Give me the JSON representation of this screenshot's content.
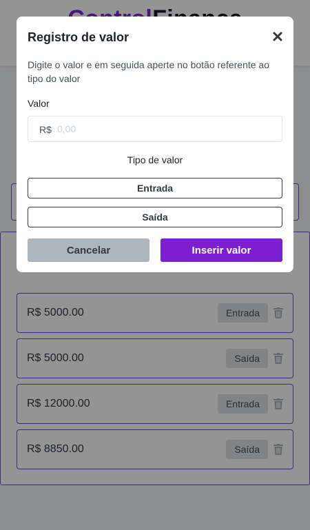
{
  "app": {
    "brand_part1": "Control",
    "brand_part2": "Finance"
  },
  "modal": {
    "title": "Registro de valor",
    "close_icon": "close-icon",
    "description": "Digite o valor e em seguida aperte no botão referente ao tipo do valor",
    "value_label": "Valor",
    "currency_prefix": "R$",
    "value_input": {
      "value": "",
      "placeholder": "0,00"
    },
    "type_label": "Tipo de valor",
    "entrada_button": "Entrada",
    "saida_button": "Saída",
    "cancel_button": "Cancelar",
    "insert_button": "Inserir valor"
  },
  "list": {
    "items": [
      {
        "value": "R$ 5000.00",
        "type": "Entrada"
      },
      {
        "value": "R$ 5000.00",
        "type": "Saída"
      },
      {
        "value": "R$ 12000.00",
        "type": "Entrada"
      },
      {
        "value": "R$ 8850.00",
        "type": "Saída"
      }
    ],
    "delete_icon": "trash-icon"
  },
  "colors": {
    "accent": "#7b1fd1",
    "border": "#6c4fd1",
    "overlay": "rgba(0,0,0,0.42)"
  }
}
